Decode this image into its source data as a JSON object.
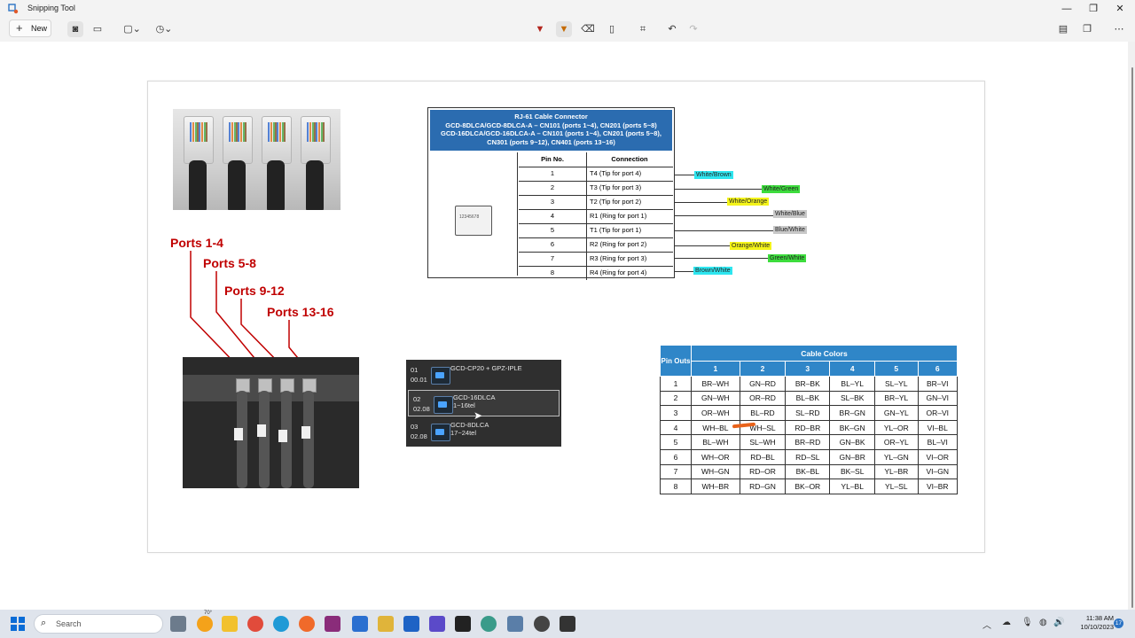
{
  "window": {
    "title": "Snipping Tool",
    "minimize": "—",
    "maximize": "❐",
    "close": "✕"
  },
  "toolbar": {
    "new_label": "New"
  },
  "photo_labels": [
    "Ports 1-4",
    "Ports 5-8",
    "Ports 9-12",
    "Ports 13-16"
  ],
  "rj61": {
    "header_lines": [
      "RJ-61 Cable Connector",
      "GCD-8DLCA/GCD-8DLCA-A – CN101 (ports 1~4), CN201 (ports 5~8)",
      "GCD-16DLCA/GCD-16DLCA-A – CN101 (ports 1~4), CN201 (ports 5~8),",
      "CN301 (ports 9~12), CN401 (ports 13~16)"
    ],
    "jack_pins": "12345678",
    "col_headers": [
      "Pin No.",
      "Connection"
    ],
    "rows": [
      {
        "pin": "1",
        "connection": "T4 (Tip for port 4)"
      },
      {
        "pin": "2",
        "connection": "T3 (Tip for port 3)"
      },
      {
        "pin": "3",
        "connection": "T2 (Tip for port 2)"
      },
      {
        "pin": "4",
        "connection": "R1 (Ring for port 1)"
      },
      {
        "pin": "5",
        "connection": "T1 (Tip for port 1)"
      },
      {
        "pin": "6",
        "connection": "R2 (Ring for port 2)"
      },
      {
        "pin": "7",
        "connection": "R3 (Ring for port 3)"
      },
      {
        "pin": "8",
        "connection": "R4 (Ring for port 4)"
      }
    ],
    "wire_tags": [
      {
        "text": "White/Brown",
        "color": "#2ee6f0"
      },
      {
        "text": "White/Green",
        "color": "#3ddc3d"
      },
      {
        "text": "White/Orange",
        "color": "#f4f41a"
      },
      {
        "text": "White/Blue",
        "color": "#c8c8c8"
      },
      {
        "text": "Blue/White",
        "color": "#c8c8c8"
      },
      {
        "text": "Orange/White",
        "color": "#f4f41a"
      },
      {
        "text": "Green/White",
        "color": "#3ddc3d"
      },
      {
        "text": "Brown/White",
        "color": "#2ee6f0"
      }
    ]
  },
  "slots": [
    {
      "num": "01",
      "sub": "00.01",
      "name": "GCD-CP20 + GPZ-IPLE",
      "detail": ""
    },
    {
      "num": "02",
      "sub": "02.08",
      "name": "GCD-16DLCA",
      "detail": "1~16tel"
    },
    {
      "num": "03",
      "sub": "02.08",
      "name": "GCD-8DLCA",
      "detail": "17~24tel"
    }
  ],
  "cable_colors": {
    "title": "Cable Colors",
    "pin_header": "Pin Outs",
    "columns": [
      "1",
      "2",
      "3",
      "4",
      "5",
      "6"
    ],
    "rows": [
      [
        "1",
        "BR–WH",
        "GN–RD",
        "BR–BK",
        "BL–YL",
        "SL–YL",
        "BR–VI"
      ],
      [
        "2",
        "GN–WH",
        "OR–RD",
        "BL–BK",
        "SL–BK",
        "BR–YL",
        "GN–VI"
      ],
      [
        "3",
        "OR–WH",
        "BL–RD",
        "SL–RD",
        "BR–GN",
        "GN–YL",
        "OR–VI"
      ],
      [
        "4",
        "WH–BL",
        "WH–SL",
        "RD–BR",
        "BK–GN",
        "YL–OR",
        "VI–BL"
      ],
      [
        "5",
        "BL–WH",
        "SL–WH",
        "BR–RD",
        "GN–BK",
        "OR–YL",
        "BL–VI"
      ],
      [
        "6",
        "WH–OR",
        "RD–BL",
        "RD–SL",
        "GN–BR",
        "YL–GN",
        "VI–OR"
      ],
      [
        "7",
        "WH–GN",
        "RD–OR",
        "BK–BL",
        "BK–SL",
        "YL–BR",
        "VI–GN"
      ],
      [
        "8",
        "WH–BR",
        "RD–GN",
        "BK–OR",
        "YL–BL",
        "YL–SL",
        "VI–BR"
      ]
    ]
  },
  "taskbar": {
    "search_placeholder": "Search",
    "weather": "70°",
    "time": "11:38 AM",
    "date": "10/10/2023",
    "notifications": "17"
  }
}
